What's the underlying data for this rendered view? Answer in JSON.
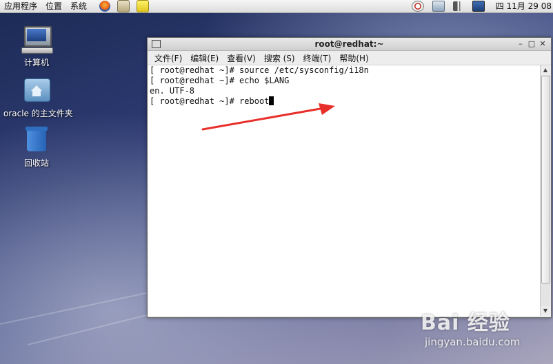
{
  "top_panel": {
    "menus": [
      "应用程序",
      "位置",
      "系统"
    ],
    "clock": "四 11月 29 08"
  },
  "desktop": {
    "icons": [
      {
        "label": "计算机"
      },
      {
        "label": "oracle 的主文件夹"
      },
      {
        "label": "回收站"
      }
    ]
  },
  "terminal": {
    "title": "root@redhat:~",
    "controls": {
      "minimize": "–",
      "maximize": "□",
      "close": "✕"
    },
    "menu": [
      "文件(F)",
      "编辑(E)",
      "查看(V)",
      "搜索 (S)",
      "终端(T)",
      "帮助(H)"
    ],
    "lines": [
      "[ root@redhat ~]# source /etc/sysconfig/i18n",
      "[ root@redhat ~]# echo $LANG",
      "en. UTF-8",
      "[ root@redhat ~]# reboot"
    ]
  },
  "watermark": {
    "brand": "Bai 经验",
    "url": "jingyan.baidu.com"
  },
  "colors": {
    "arrow": "#e8302b",
    "terminal_bg": "#ffffff"
  }
}
